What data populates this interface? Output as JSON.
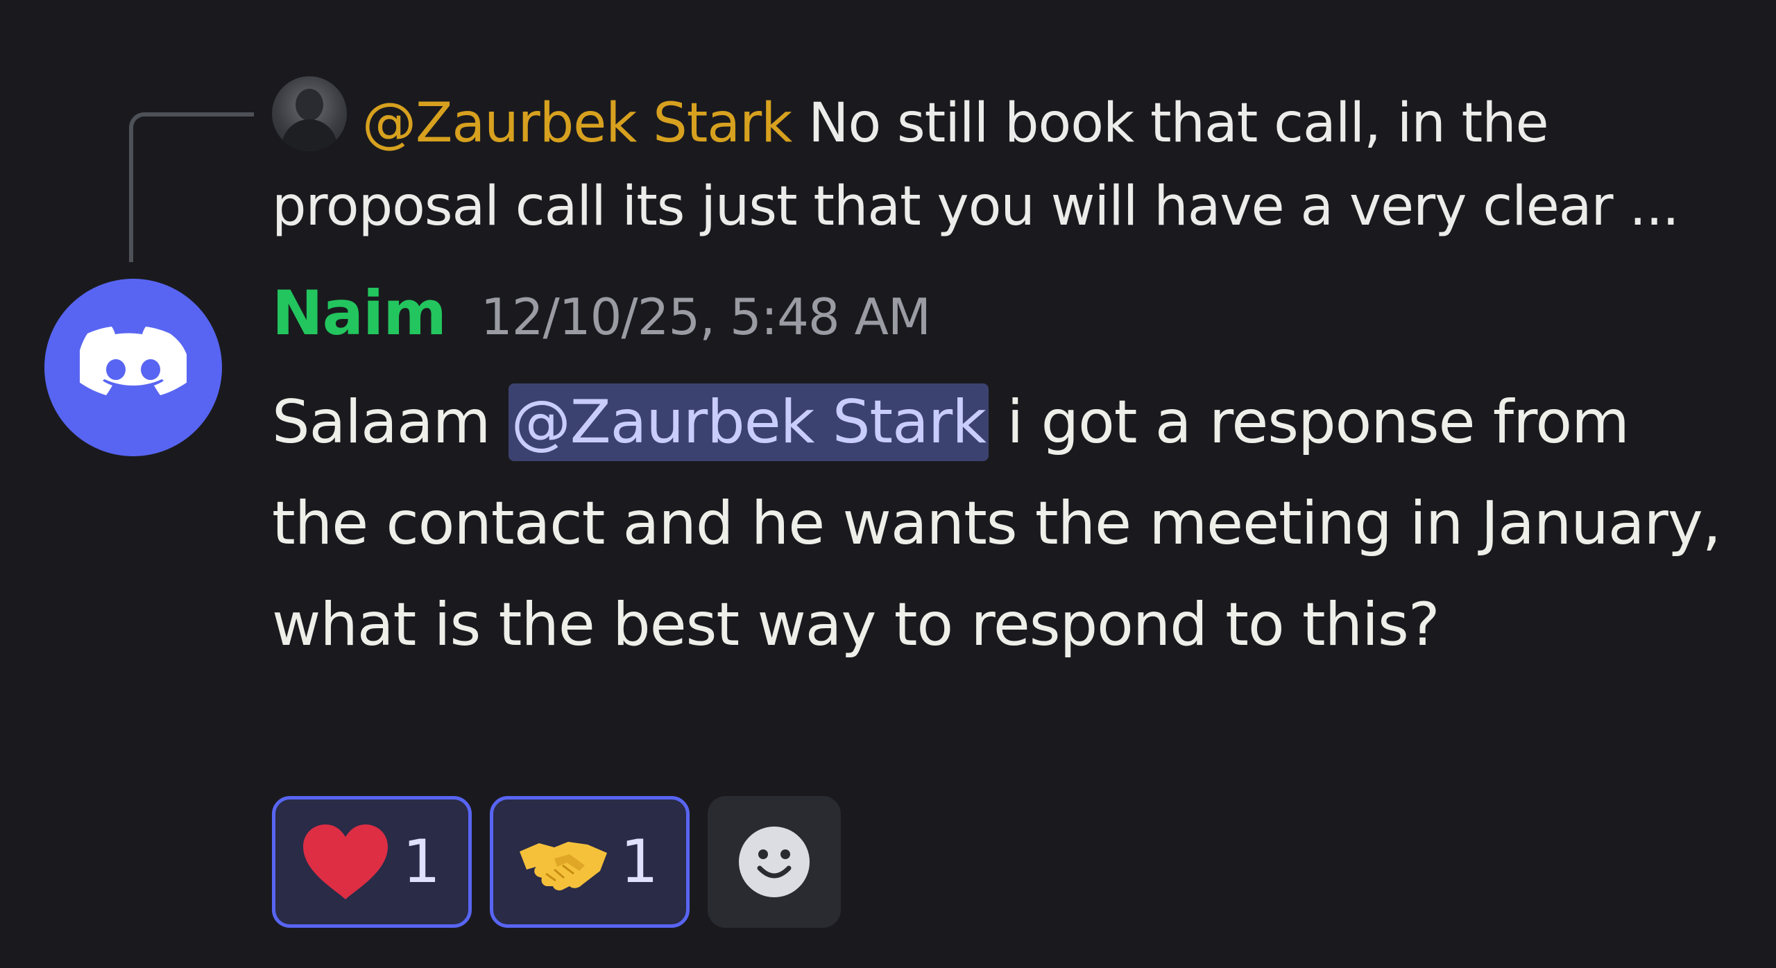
{
  "reply": {
    "mention": "@Zaurbek Stark",
    "text": " No still book that call, in the proposal call its just that you will have a very clear ..."
  },
  "message": {
    "author": "Naim",
    "timestamp": "12/10/25, 5:48 AM",
    "text_before": "Salaam ",
    "mention": "@Zaurbek Stark",
    "text_after": " i got a response from the contact and he wants the meeting in January, what is the best way to respond to this?"
  },
  "reactions": [
    {
      "icon": "heart-icon",
      "count": "1"
    },
    {
      "icon": "handshake-icon",
      "count": "1"
    }
  ],
  "add_reaction_icon": "smiley-icon",
  "colors": {
    "background": "#1a1a1e",
    "author": "#23c55e",
    "reply_mention": "#d7a11f",
    "mention_bg": "#3c4270",
    "discord_blurple": "#5865f2"
  }
}
